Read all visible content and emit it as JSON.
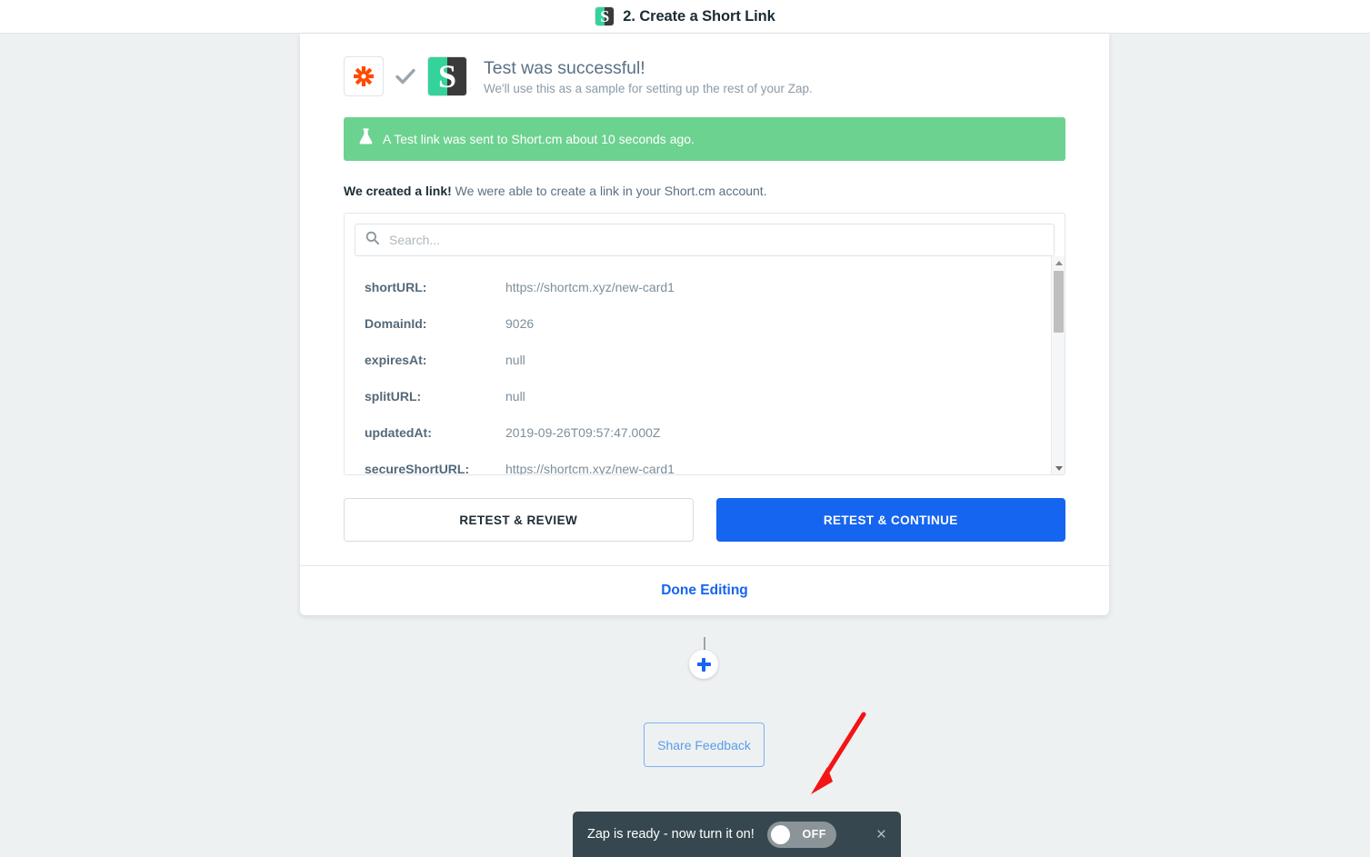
{
  "header": {
    "title": "2. Create a Short Link",
    "logo_icon": "shortcm-logo-icon",
    "logo_letter": "S"
  },
  "result": {
    "zapier_icon": "zapier-asterisk-icon",
    "check_icon": "check-icon",
    "app_icon": "shortcm-logo-icon",
    "app_letter": "S",
    "title": "Test was successful!",
    "subtitle": "We'll use this as a sample for setting up the rest of your Zap."
  },
  "banner": {
    "icon": "flask-icon",
    "text": "A Test link was sent to Short.cm about 10 seconds ago.",
    "color": "#6cd28f"
  },
  "created": {
    "bold": "We created a link!",
    "rest": " We were able to create a link in your Short.cm account."
  },
  "search": {
    "icon": "search-icon",
    "placeholder": "Search...",
    "value": ""
  },
  "data_rows": [
    {
      "key": "shortURL:",
      "value": "https://shortcm.xyz/new-card1"
    },
    {
      "key": "DomainId:",
      "value": "9026"
    },
    {
      "key": "expiresAt:",
      "value": "null"
    },
    {
      "key": "splitURL:",
      "value": "null"
    },
    {
      "key": "updatedAt:",
      "value": "2019-09-26T09:57:47.000Z"
    },
    {
      "key": "secureShortURL:",
      "value": "https://shortcm.xyz/new-card1"
    }
  ],
  "scrollbar": {
    "up_icon": "scroll-up-arrow-icon",
    "down_icon": "scroll-down-arrow-icon"
  },
  "actions": {
    "retest_review": "RETEST & REVIEW",
    "retest_continue": "RETEST & CONTINUE",
    "primary_color": "#1565f0"
  },
  "done_editing": {
    "label": "Done Editing"
  },
  "add_step": {
    "icon": "plus-icon"
  },
  "feedback": {
    "label": "Share Feedback"
  },
  "annotation": {
    "arrow_icon": "red-arrow-icon",
    "color": "#f41414"
  },
  "toast": {
    "text": "Zap is ready - now turn it on!",
    "toggle_label": "OFF",
    "toggle_state": "off",
    "close_icon": "close-icon"
  }
}
